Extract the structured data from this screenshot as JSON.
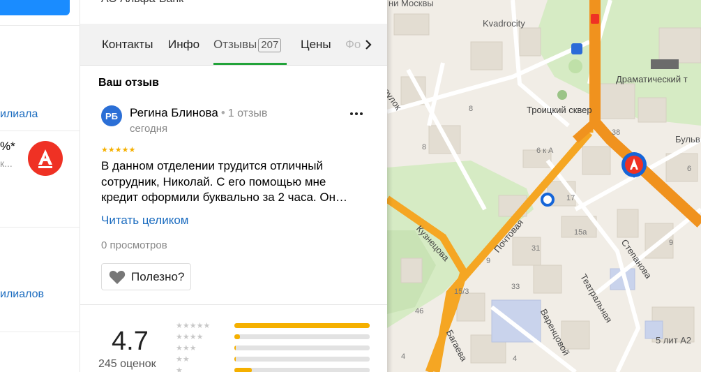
{
  "left_panel": {
    "branch_link": "илиала",
    "percent": "%*",
    "dots": "к...",
    "branches_link": "илиалов",
    "bank_letter": "А"
  },
  "panel": {
    "top_title": "АО Альфа-Банк",
    "tabs": [
      {
        "label": "Контакты"
      },
      {
        "label": "Инфо"
      },
      {
        "label": "Отзывы",
        "badge": "207"
      },
      {
        "label": "Цены"
      },
      {
        "label": "Фо"
      }
    ],
    "your_review": "Ваш отзыв",
    "review": {
      "avatar_initials": "РБ",
      "author": "Регина Блинова",
      "author_reviews": "1 отзыв",
      "date": "сегодня",
      "stars": "★★★★★",
      "text": "В данном отделении трудится отличный сотрудник, Николай. С его помощью мне кредит оформили буквально за 2 часа. Он…",
      "read_more": "Читать целиком",
      "views": "0 просмотров",
      "useful": "Полезно?"
    },
    "rating": {
      "value": "4.7",
      "count": "245 оценок",
      "distribution": [
        {
          "stars": "★★★★★",
          "fraction": 1.0
        },
        {
          "stars": "★★★★",
          "fraction": 0.04
        },
        {
          "stars": "★★★",
          "fraction": 0.01
        },
        {
          "stars": "★★",
          "fraction": 0.01
        },
        {
          "stars": "★",
          "fraction": 0.13
        }
      ]
    }
  },
  "map": {
    "labels": {
      "moscow": "ни Москвы",
      "kvadrocity": "Kvadrocity",
      "dramatic": "Драматический т",
      "trinity_square": "Троицкий сквер",
      "boulevard": "Бульв",
      "pereulok": "реулок",
      "kuznetsova": "Кузнецова",
      "pochtovaya": "Почтовая",
      "stepanova": "Степанова",
      "teatralnaya": "Театральная",
      "varentsovoy": "Варенцовой",
      "bagaeva": "Багаева",
      "five_lit": "5 лит А2"
    },
    "house_numbers": [
      "8",
      "8",
      "6 к А",
      "38",
      "17",
      "15а",
      "9",
      "31",
      "33",
      "9",
      "15/3",
      "46",
      "4",
      "6",
      "4"
    ],
    "marker_letter": "А",
    "colors": {
      "main_road": "#f5a623",
      "highway": "#f0921e",
      "park": "#c5e4b0",
      "marker": "#1565d8",
      "alfa": "#ef3124"
    }
  }
}
